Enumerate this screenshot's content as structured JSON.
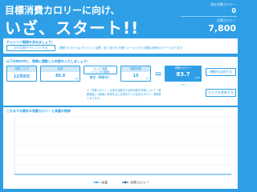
{
  "header": {
    "title_line1": "目標消費カロリーに向け、",
    "title_line2": "いざ、スタート!!"
  },
  "stats": {
    "current_label": "現在消費カロリー",
    "current_value": "0",
    "target_label": "目標カロリー",
    "target_value": "7,800"
  },
  "challenge": {
    "heading": "チャレンジ期間を決めましょう！",
    "button_label": "3か月間チャレンジする",
    "note": "期間 90 日 5 kg ダイエット目標、週 3 回 60 分間ウォーキングで必要な消費カロリーとなります"
  },
  "input": {
    "heading": "以下の枠の中に、実際に運動した内容を入力しましょう！",
    "fields": [
      {
        "head": "運動した日",
        "value": "12月8日",
        "unit": ""
      },
      {
        "head": "体重",
        "value": "45.0",
        "unit": "kg"
      },
      {
        "head_line1": "行った運動",
        "head_line2": "(ジムでの運動)",
        "value": "歩き（早歩き）",
        "unit": ""
      },
      {
        "head": "運動時間",
        "value": "15",
        "unit": "分"
      }
    ],
    "equals": "=",
    "result_head": "消費カロリー",
    "result_value": "83.7",
    "result_unit": "kcal",
    "result_pct": "1%",
    "note": "＊「消費カロリー」は体の活動または体の動作状態について「運動強度」の数値と体重を元に計算を行った目安のカロリー消費量となります。",
    "record_button": "運動を記録する",
    "graph_button": "グラフを更新する"
  },
  "chart": {
    "heading": "これまでの累計の消費カロリーと体重の推移"
  },
  "chart_data": {
    "type": "line",
    "x": [],
    "series": [
      {
        "name": "体重",
        "values": []
      },
      {
        "name": "消費カロリー",
        "values": []
      }
    ],
    "legend": "bottom-center",
    "grid": true
  }
}
